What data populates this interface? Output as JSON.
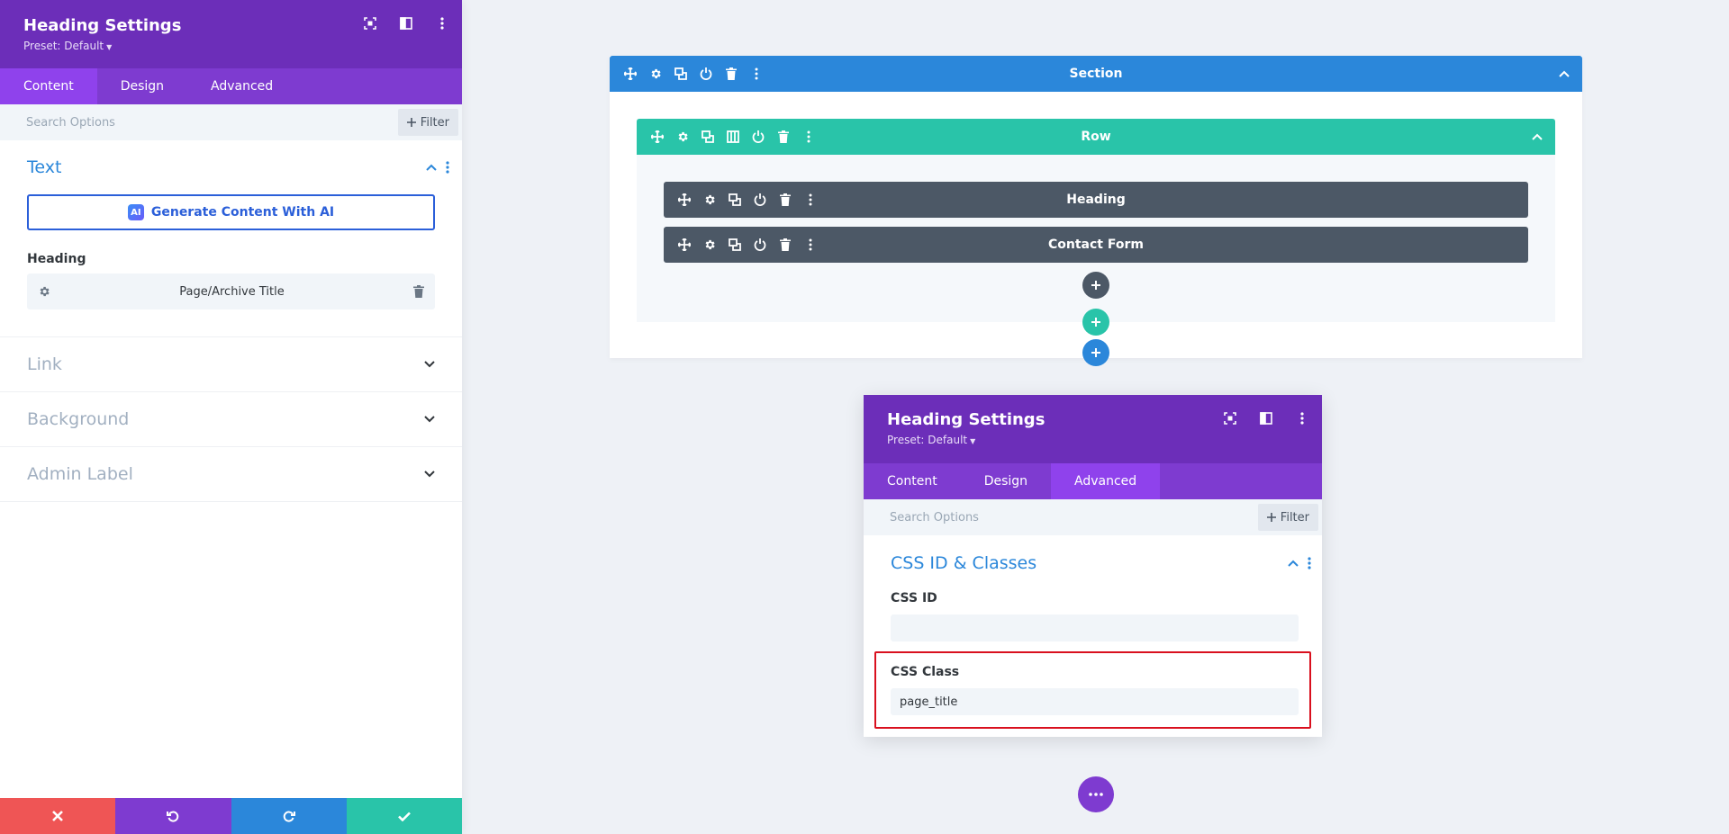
{
  "left_panel": {
    "title": "Heading Settings",
    "preset": "Preset: Default",
    "tabs": [
      {
        "label": "Content",
        "active": true
      },
      {
        "label": "Design",
        "active": false
      },
      {
        "label": "Advanced",
        "active": false
      }
    ],
    "search_placeholder": "Search Options",
    "filter_label": "Filter",
    "sections": {
      "text": {
        "title": "Text",
        "ai_button_label": "Generate Content With AI",
        "ai_badge": "AI",
        "heading_label": "Heading",
        "heading_value": "Page/Archive Title"
      },
      "link": {
        "title": "Link"
      },
      "background": {
        "title": "Background"
      },
      "admin_label": {
        "title": "Admin Label"
      }
    }
  },
  "canvas": {
    "section_label": "Section",
    "row_label": "Row",
    "modules": [
      {
        "label": "Heading"
      },
      {
        "label": "Contact Form"
      }
    ]
  },
  "modal": {
    "title": "Heading Settings",
    "preset": "Preset: Default",
    "tabs": [
      {
        "label": "Content",
        "active": false
      },
      {
        "label": "Design",
        "active": false
      },
      {
        "label": "Advanced",
        "active": true
      }
    ],
    "search_placeholder": "Search Options",
    "filter_label": "Filter",
    "section_title": "CSS ID & Classes",
    "css_id_label": "CSS ID",
    "css_id_value": "",
    "css_class_label": "CSS Class",
    "css_class_value": "page_title"
  },
  "colors": {
    "purple_header": "#6c2eb9",
    "purple_tabs": "#7e3bd0",
    "section_blue": "#2b87da",
    "row_teal": "#29c4a9",
    "module_gray": "#4c5866",
    "cancel_red": "#ef5555",
    "undo_purple": "#7e3bd0",
    "redo_blue": "#2b87da",
    "save_green": "#29c4a9",
    "highlight_red": "#d9101e"
  }
}
